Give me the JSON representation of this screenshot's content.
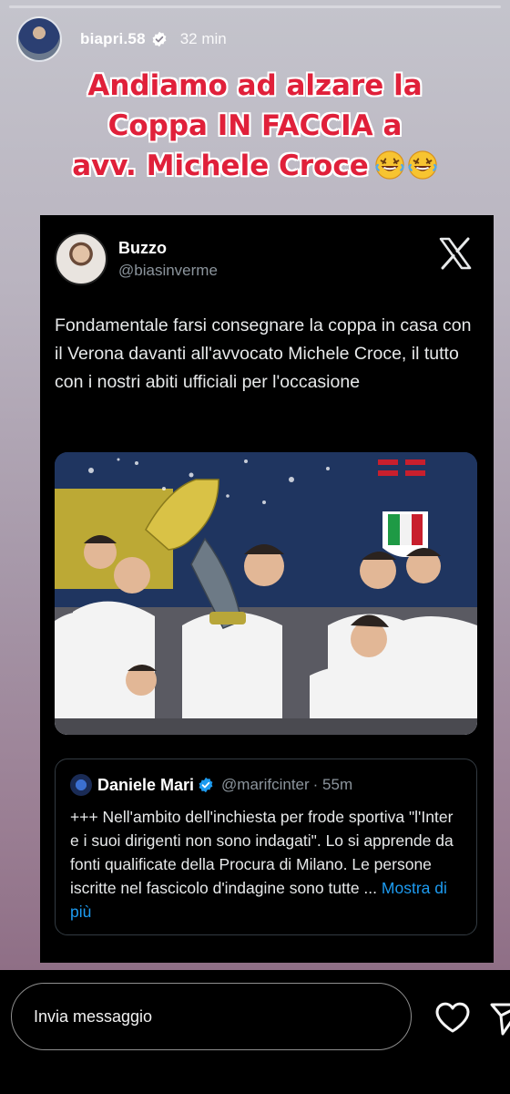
{
  "story": {
    "progress": 0.0,
    "username": "biapri.58",
    "time_ago": "32 min",
    "avatar_icon": "user-avatar",
    "verified_icon": "verified-badge-icon",
    "caption_lines": [
      "Andiamo ad alzare la",
      "Coppa IN FACCIA a",
      "avv. Michele Croce"
    ],
    "caption_emoji": [
      "🤣",
      "🤣"
    ],
    "caption_color": "#e0203a"
  },
  "tweet": {
    "name": "Buzzo",
    "handle": "@biasinverme",
    "platform_icon": "x-logo-icon",
    "text": "Fondamentale farsi consegnare la coppa in casa con il Verona davanti all'avvocato Michele Croce, il tutto con i nostri abiti ufficiali per l'occasione",
    "photo_icon": "team-trophy-photo",
    "quoted": {
      "name": "Daniele Mari",
      "handle": "@marifcinter",
      "time": "· 55m",
      "text": "+++ Nell'ambito dell'inchiesta per frode sportiva \"l'Inter e i suoi dirigenti non sono indagati\". Lo si apprende da fonti qualificate della Procura di Milano. Le persone iscritte nel fascicolo d'indagine sono tutte ...",
      "more_label": "Mostra di più",
      "link_color": "#1d9bf0"
    }
  },
  "composer": {
    "placeholder": "Invia messaggio",
    "like_icon": "heart-icon",
    "share_icon": "send-icon"
  }
}
